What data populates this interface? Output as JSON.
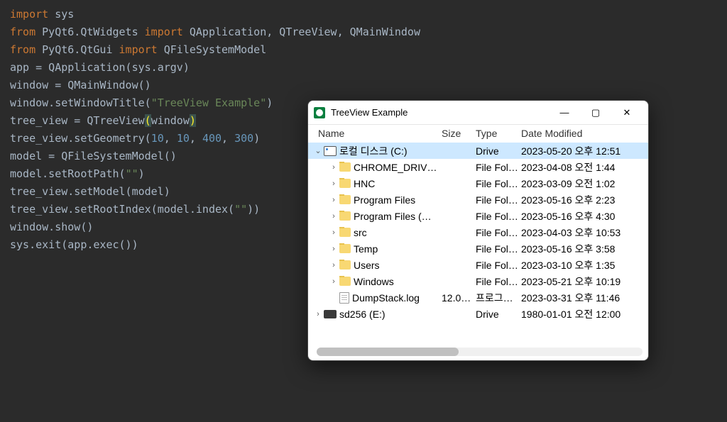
{
  "code": {
    "lines": [
      {
        "t": [
          [
            "kw",
            "import"
          ],
          [
            "fn",
            " sys"
          ]
        ]
      },
      {
        "t": [
          [
            "kw",
            "from"
          ],
          [
            "fn",
            " PyQt6.QtWidgets "
          ],
          [
            "kw",
            "import"
          ],
          [
            "fn",
            " QApplication, QTreeView, QMainWindow"
          ]
        ]
      },
      {
        "t": [
          [
            "kw",
            "from"
          ],
          [
            "fn",
            " PyQt6.QtGui "
          ],
          [
            "kw",
            "import"
          ],
          [
            "fn",
            " QFileSystemModel"
          ]
        ]
      },
      {
        "t": [
          [
            "fn",
            ""
          ]
        ]
      },
      {
        "t": [
          [
            "fn",
            "app = QApplication(sys.argv)"
          ]
        ]
      },
      {
        "t": [
          [
            "fn",
            ""
          ]
        ]
      },
      {
        "t": [
          [
            "fn",
            "window = QMainWindow()"
          ]
        ]
      },
      {
        "t": [
          [
            "fn",
            "window.setWindowTitle("
          ],
          [
            "str",
            "\"TreeView Example\""
          ],
          [
            "fn",
            ")"
          ]
        ]
      },
      {
        "t": [
          [
            "fn",
            ""
          ]
        ]
      },
      {
        "t": [
          [
            "fn",
            "tree_view = QTreeView"
          ],
          [
            "paren-hl",
            "("
          ],
          [
            "fn",
            "window"
          ],
          [
            "paren-hl",
            ")"
          ]
        ]
      },
      {
        "t": [
          [
            "fn",
            "tree_view.setGeometry("
          ],
          [
            "num",
            "10"
          ],
          [
            "fn",
            ", "
          ],
          [
            "num",
            "10"
          ],
          [
            "fn",
            ", "
          ],
          [
            "num",
            "400"
          ],
          [
            "fn",
            ", "
          ],
          [
            "num",
            "300"
          ],
          [
            "fn",
            ")"
          ]
        ]
      },
      {
        "t": [
          [
            "fn",
            ""
          ]
        ]
      },
      {
        "t": [
          [
            "fn",
            "model = QFileSystemModel()"
          ]
        ]
      },
      {
        "t": [
          [
            "fn",
            "model.setRootPath("
          ],
          [
            "str",
            "\"\""
          ],
          [
            "fn",
            ")"
          ]
        ]
      },
      {
        "t": [
          [
            "fn",
            "tree_view.setModel(model)"
          ]
        ]
      },
      {
        "t": [
          [
            "fn",
            "tree_view.setRootIndex(model.index("
          ],
          [
            "str",
            "\"\""
          ],
          [
            "fn",
            "))"
          ]
        ]
      },
      {
        "t": [
          [
            "fn",
            ""
          ]
        ]
      },
      {
        "t": [
          [
            "fn",
            "window.show()"
          ]
        ]
      },
      {
        "t": [
          [
            "fn",
            "sys.exit(app.exec())"
          ]
        ]
      }
    ]
  },
  "window": {
    "title": "TreeView Example",
    "columns": {
      "name": "Name",
      "size": "Size",
      "type": "Type",
      "date": "Date Modified"
    },
    "rows": [
      {
        "indent": 0,
        "expander": "v",
        "icon": "drive",
        "name": "로컬 디스크 (C:)",
        "size": "",
        "type": "Drive",
        "date": "2023-05-20 오후 12:51",
        "selected": true
      },
      {
        "indent": 1,
        "expander": ">",
        "icon": "folder",
        "name": "CHROME_DRIV…",
        "size": "",
        "type": "File Fol…",
        "date": "2023-04-08 오전 1:44"
      },
      {
        "indent": 1,
        "expander": ">",
        "icon": "folder",
        "name": "HNC",
        "size": "",
        "type": "File Fol…",
        "date": "2023-03-09 오전 1:02"
      },
      {
        "indent": 1,
        "expander": ">",
        "icon": "folder",
        "name": "Program Files",
        "size": "",
        "type": "File Fol…",
        "date": "2023-05-16 오후 2:23"
      },
      {
        "indent": 1,
        "expander": ">",
        "icon": "folder",
        "name": "Program Files (…",
        "size": "",
        "type": "File Fol…",
        "date": "2023-05-16 오후 4:30"
      },
      {
        "indent": 1,
        "expander": ">",
        "icon": "folder",
        "name": "src",
        "size": "",
        "type": "File Fol…",
        "date": "2023-04-03 오후 10:53"
      },
      {
        "indent": 1,
        "expander": ">",
        "icon": "folder",
        "name": "Temp",
        "size": "",
        "type": "File Fol…",
        "date": "2023-05-16 오후 3:58"
      },
      {
        "indent": 1,
        "expander": ">",
        "icon": "folder",
        "name": "Users",
        "size": "",
        "type": "File Fol…",
        "date": "2023-03-10 오후 1:35"
      },
      {
        "indent": 1,
        "expander": ">",
        "icon": "folder",
        "name": "Windows",
        "size": "",
        "type": "File Fol…",
        "date": "2023-05-21 오후 10:19"
      },
      {
        "indent": 1,
        "expander": "",
        "icon": "file",
        "name": "DumpStack.log",
        "size": "12.00 …",
        "type": "프로그…",
        "date": "2023-03-31 오후 11:46"
      },
      {
        "indent": 0,
        "expander": ">",
        "icon": "drivedark",
        "name": "sd256 (E:)",
        "size": "",
        "type": "Drive",
        "date": "1980-01-01 오전 12:00"
      }
    ]
  },
  "glyphs": {
    "min": "—",
    "max": "▢",
    "close": "✕",
    "down": "⌄",
    "right": "›"
  }
}
